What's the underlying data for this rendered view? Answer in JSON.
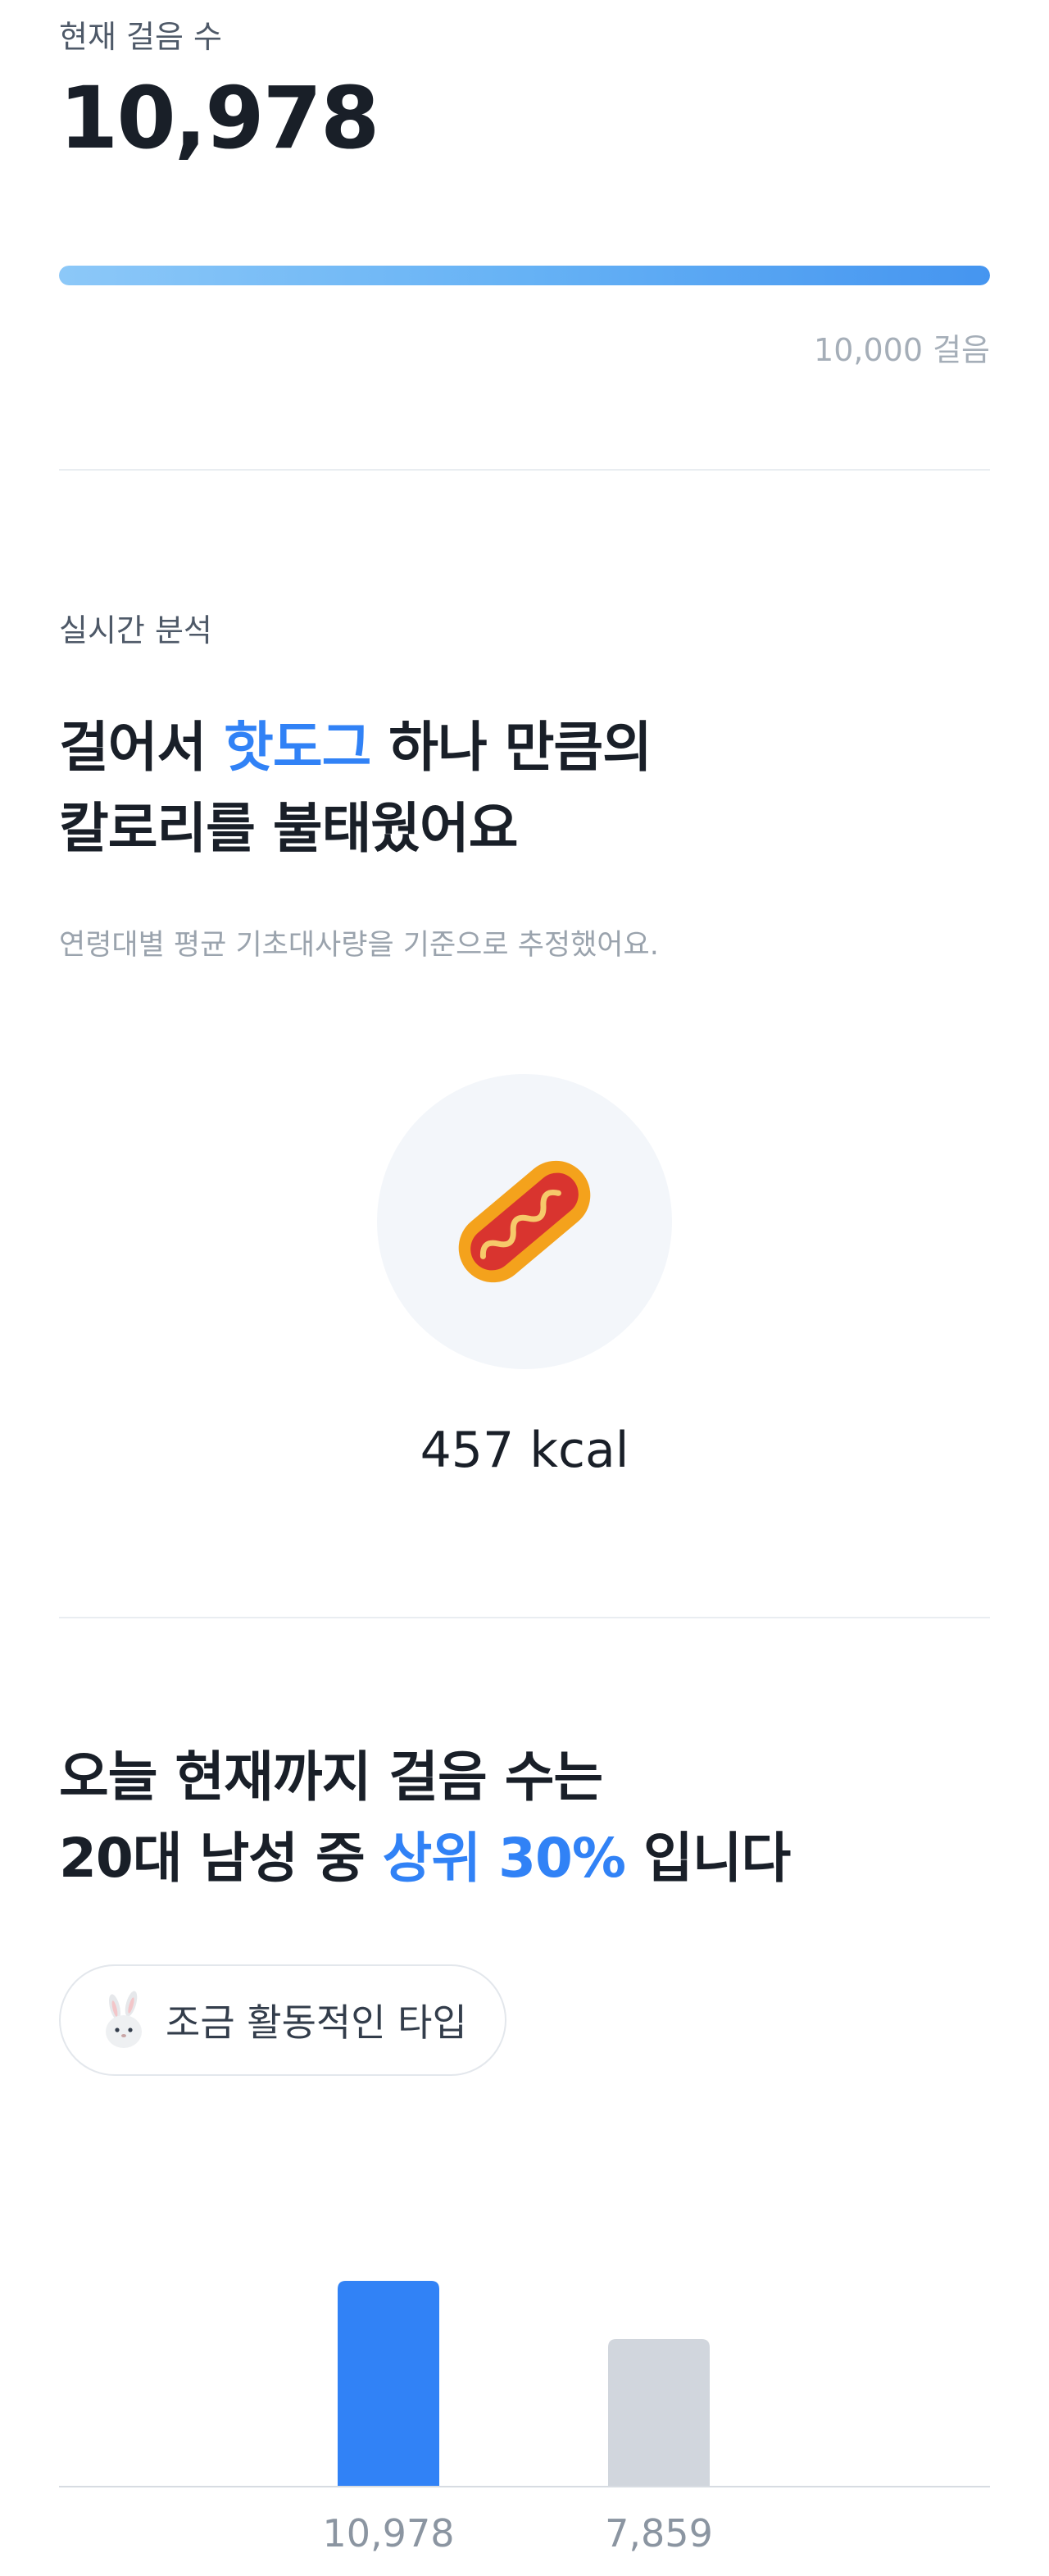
{
  "steps": {
    "label": "현재 걸음 수",
    "count": "10,978",
    "goal_label": "10,000 걸음",
    "progress": 1.0
  },
  "analysis": {
    "section_label": "실시간 분석",
    "headline_line1_prefix": "걸어서 ",
    "headline_line1_accent": "핫도그",
    "headline_line1_suffix": " 하나 만큼의",
    "headline_line2": "칼로리를 불태웠어요",
    "note": "연령대별 평균 기초대사량을 기준으로 추정했어요.",
    "food_icon": "hotdog-icon",
    "kcal": "457 kcal"
  },
  "rank": {
    "headline_line1": "오늘 현재까지 걸음 수는",
    "headline_line2_prefix": "20대 남성 중 ",
    "headline_line2_accent": "상위 30%",
    "headline_line2_suffix": " 입니다",
    "badge_icon": "rabbit-icon",
    "badge_label": "조금 활동적인 타입"
  },
  "colors": {
    "accent": "#3182f6",
    "bar_me": "#3182f6",
    "bar_avg": "#d1d6dd",
    "progress_start": "#8cc8f8",
    "progress_end": "#4595f0"
  },
  "chart_data": {
    "type": "bar",
    "categories": [
      "10,978",
      "7,859"
    ],
    "values": [
      10978,
      7859
    ],
    "title": "",
    "xlabel": "",
    "ylabel": "",
    "grid": false
  }
}
